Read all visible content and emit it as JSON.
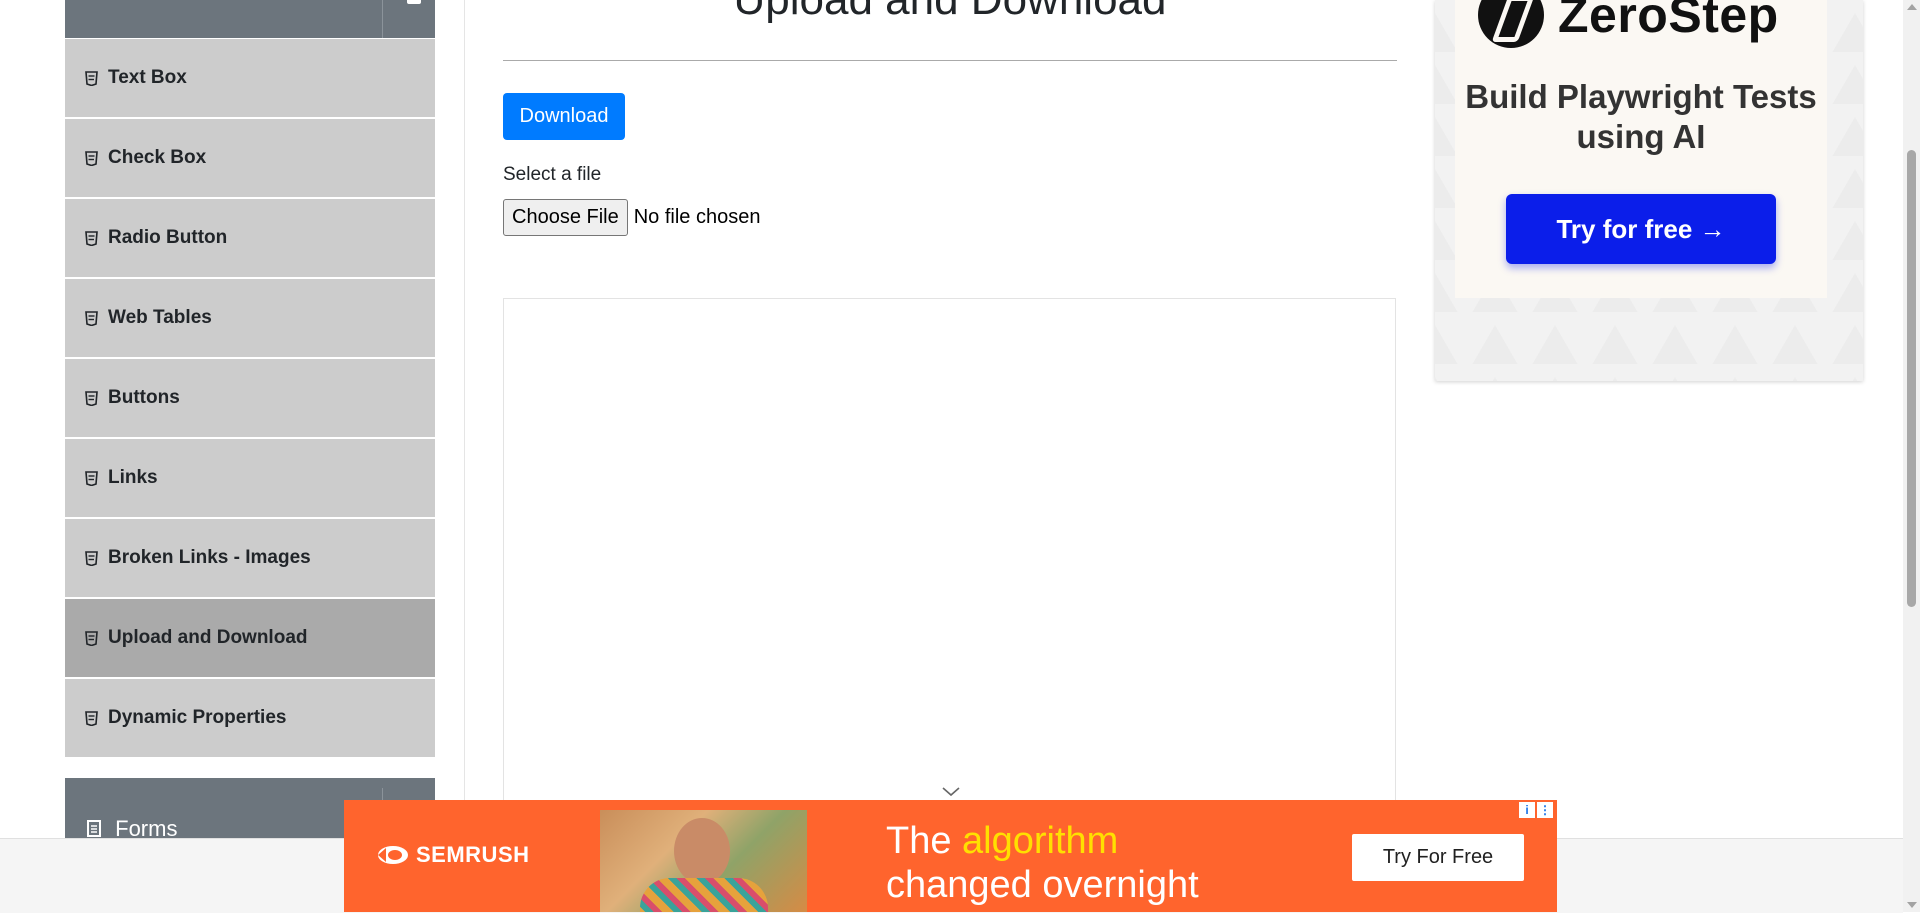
{
  "sidebar": {
    "items": [
      {
        "label": "Text Box",
        "active": false
      },
      {
        "label": "Check Box",
        "active": false
      },
      {
        "label": "Radio Button",
        "active": false
      },
      {
        "label": "Web Tables",
        "active": false
      },
      {
        "label": "Buttons",
        "active": false
      },
      {
        "label": "Links",
        "active": false
      },
      {
        "label": "Broken Links - Images",
        "active": false
      },
      {
        "label": "Upload and Download",
        "active": true
      },
      {
        "label": "Dynamic Properties",
        "active": false
      }
    ],
    "next_group": {
      "label": "Forms"
    }
  },
  "main": {
    "title": "Upload and Download",
    "download_label": "Download",
    "select_label": "Select a file",
    "choose_file_label": "Choose File",
    "no_file_text": "No file chosen"
  },
  "ad_right": {
    "brand": "ZeroStep",
    "headline": "Build Playwright Tests using AI",
    "cta": "Try for free →"
  },
  "ad_bottom": {
    "brand": "SEMRUSH",
    "line1_prefix": "The ",
    "line1_highlight": "algorithm",
    "line2": "changed overnight",
    "cta": "Try For Free",
    "info_icon": "i",
    "menu_icon": "⋮"
  },
  "colors": {
    "primary": "#007bff",
    "sidebar_header": "#6c757d",
    "sidebar_item": "#cccccc",
    "sidebar_active": "#aaaaaa",
    "ad_bottom_bg": "#ff642d",
    "ad_right_cta": "#0b1eea"
  }
}
